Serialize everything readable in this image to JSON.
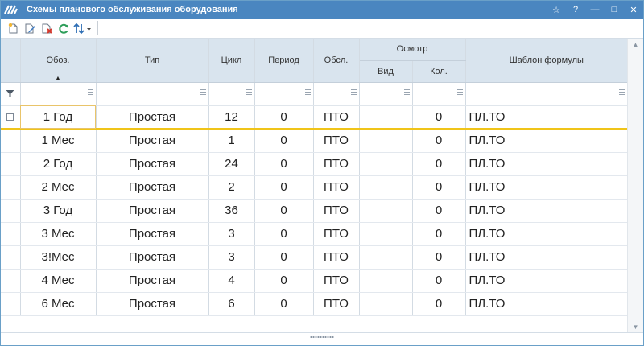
{
  "window": {
    "title": "Схемы планового обслуживания оборудования",
    "buttons": {
      "star": "☆",
      "help": "?",
      "minimize": "—",
      "maximize": "□",
      "close": "✕"
    }
  },
  "toolbar": {
    "icons": [
      "new-document-icon",
      "edit-icon",
      "delete-icon",
      "refresh-icon",
      "sort-icon"
    ]
  },
  "table": {
    "headers": {
      "code": "Обоз.",
      "type": "Тип",
      "cycle": "Цикл",
      "period": "Период",
      "service": "Обсл.",
      "inspection": "Осмотр",
      "kind": "Вид",
      "count": "Кол.",
      "formula": "Шаблон формулы"
    },
    "rows": [
      {
        "code": "1 Год",
        "type": "Простая",
        "cycle": "12",
        "period": "0",
        "service": "ПТО",
        "kind": "",
        "count": "0",
        "formula": "ПЛ.ТО"
      },
      {
        "code": "1 Мес",
        "type": "Простая",
        "cycle": "1",
        "period": "0",
        "service": "ПТО",
        "kind": "",
        "count": "0",
        "formula": "ПЛ.ТО"
      },
      {
        "code": "2 Год",
        "type": "Простая",
        "cycle": "24",
        "period": "0",
        "service": "ПТО",
        "kind": "",
        "count": "0",
        "formula": "ПЛ.ТО"
      },
      {
        "code": "2 Мес",
        "type": "Простая",
        "cycle": "2",
        "period": "0",
        "service": "ПТО",
        "kind": "",
        "count": "0",
        "formula": "ПЛ.ТО"
      },
      {
        "code": "3 Год",
        "type": "Простая",
        "cycle": "36",
        "period": "0",
        "service": "ПТО",
        "kind": "",
        "count": "0",
        "formula": "ПЛ.ТО"
      },
      {
        "code": "3 Мес",
        "type": "Простая",
        "cycle": "3",
        "period": "0",
        "service": "ПТО",
        "kind": "",
        "count": "0",
        "formula": "ПЛ.ТО"
      },
      {
        "code": "3!Мес",
        "type": "Простая",
        "cycle": "3",
        "period": "0",
        "service": "ПТО",
        "kind": "",
        "count": "0",
        "formula": "ПЛ.ТО"
      },
      {
        "code": "4 Мес",
        "type": "Простая",
        "cycle": "4",
        "period": "0",
        "service": "ПТО",
        "kind": "",
        "count": "0",
        "formula": "ПЛ.ТО"
      },
      {
        "code": "6 Мес",
        "type": "Простая",
        "cycle": "6",
        "period": "0",
        "service": "ПТО",
        "kind": "",
        "count": "0",
        "formula": "ПЛ.ТО"
      }
    ]
  },
  "colors": {
    "title_bar": "#4a86c0",
    "header_bg": "#d9e4ee",
    "selection_line": "#f0c419"
  }
}
